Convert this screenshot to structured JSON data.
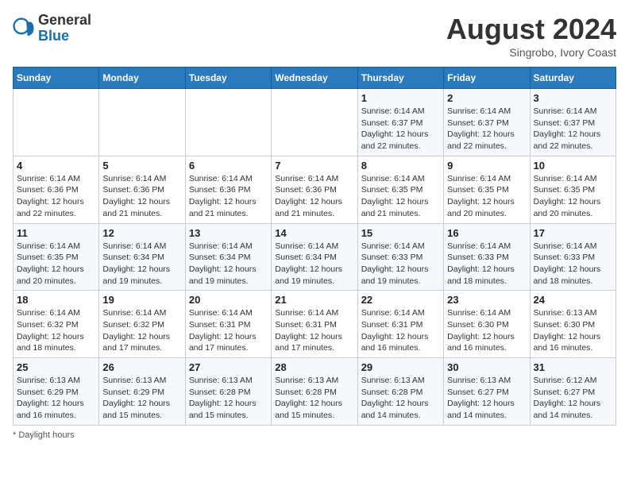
{
  "header": {
    "logo_general": "General",
    "logo_blue": "Blue",
    "month_year": "August 2024",
    "location": "Singrobo, Ivory Coast"
  },
  "days_of_week": [
    "Sunday",
    "Monday",
    "Tuesday",
    "Wednesday",
    "Thursday",
    "Friday",
    "Saturday"
  ],
  "weeks": [
    [
      {
        "day": "",
        "sunrise": "",
        "sunset": "",
        "daylight": ""
      },
      {
        "day": "",
        "sunrise": "",
        "sunset": "",
        "daylight": ""
      },
      {
        "day": "",
        "sunrise": "",
        "sunset": "",
        "daylight": ""
      },
      {
        "day": "",
        "sunrise": "",
        "sunset": "",
        "daylight": ""
      },
      {
        "day": "1",
        "sunrise": "Sunrise: 6:14 AM",
        "sunset": "Sunset: 6:37 PM",
        "daylight": "Daylight: 12 hours and 22 minutes."
      },
      {
        "day": "2",
        "sunrise": "Sunrise: 6:14 AM",
        "sunset": "Sunset: 6:37 PM",
        "daylight": "Daylight: 12 hours and 22 minutes."
      },
      {
        "day": "3",
        "sunrise": "Sunrise: 6:14 AM",
        "sunset": "Sunset: 6:37 PM",
        "daylight": "Daylight: 12 hours and 22 minutes."
      }
    ],
    [
      {
        "day": "4",
        "sunrise": "Sunrise: 6:14 AM",
        "sunset": "Sunset: 6:36 PM",
        "daylight": "Daylight: 12 hours and 22 minutes."
      },
      {
        "day": "5",
        "sunrise": "Sunrise: 6:14 AM",
        "sunset": "Sunset: 6:36 PM",
        "daylight": "Daylight: 12 hours and 21 minutes."
      },
      {
        "day": "6",
        "sunrise": "Sunrise: 6:14 AM",
        "sunset": "Sunset: 6:36 PM",
        "daylight": "Daylight: 12 hours and 21 minutes."
      },
      {
        "day": "7",
        "sunrise": "Sunrise: 6:14 AM",
        "sunset": "Sunset: 6:36 PM",
        "daylight": "Daylight: 12 hours and 21 minutes."
      },
      {
        "day": "8",
        "sunrise": "Sunrise: 6:14 AM",
        "sunset": "Sunset: 6:35 PM",
        "daylight": "Daylight: 12 hours and 21 minutes."
      },
      {
        "day": "9",
        "sunrise": "Sunrise: 6:14 AM",
        "sunset": "Sunset: 6:35 PM",
        "daylight": "Daylight: 12 hours and 20 minutes."
      },
      {
        "day": "10",
        "sunrise": "Sunrise: 6:14 AM",
        "sunset": "Sunset: 6:35 PM",
        "daylight": "Daylight: 12 hours and 20 minutes."
      }
    ],
    [
      {
        "day": "11",
        "sunrise": "Sunrise: 6:14 AM",
        "sunset": "Sunset: 6:35 PM",
        "daylight": "Daylight: 12 hours and 20 minutes."
      },
      {
        "day": "12",
        "sunrise": "Sunrise: 6:14 AM",
        "sunset": "Sunset: 6:34 PM",
        "daylight": "Daylight: 12 hours and 19 minutes."
      },
      {
        "day": "13",
        "sunrise": "Sunrise: 6:14 AM",
        "sunset": "Sunset: 6:34 PM",
        "daylight": "Daylight: 12 hours and 19 minutes."
      },
      {
        "day": "14",
        "sunrise": "Sunrise: 6:14 AM",
        "sunset": "Sunset: 6:34 PM",
        "daylight": "Daylight: 12 hours and 19 minutes."
      },
      {
        "day": "15",
        "sunrise": "Sunrise: 6:14 AM",
        "sunset": "Sunset: 6:33 PM",
        "daylight": "Daylight: 12 hours and 19 minutes."
      },
      {
        "day": "16",
        "sunrise": "Sunrise: 6:14 AM",
        "sunset": "Sunset: 6:33 PM",
        "daylight": "Daylight: 12 hours and 18 minutes."
      },
      {
        "day": "17",
        "sunrise": "Sunrise: 6:14 AM",
        "sunset": "Sunset: 6:33 PM",
        "daylight": "Daylight: 12 hours and 18 minutes."
      }
    ],
    [
      {
        "day": "18",
        "sunrise": "Sunrise: 6:14 AM",
        "sunset": "Sunset: 6:32 PM",
        "daylight": "Daylight: 12 hours and 18 minutes."
      },
      {
        "day": "19",
        "sunrise": "Sunrise: 6:14 AM",
        "sunset": "Sunset: 6:32 PM",
        "daylight": "Daylight: 12 hours and 17 minutes."
      },
      {
        "day": "20",
        "sunrise": "Sunrise: 6:14 AM",
        "sunset": "Sunset: 6:31 PM",
        "daylight": "Daylight: 12 hours and 17 minutes."
      },
      {
        "day": "21",
        "sunrise": "Sunrise: 6:14 AM",
        "sunset": "Sunset: 6:31 PM",
        "daylight": "Daylight: 12 hours and 17 minutes."
      },
      {
        "day": "22",
        "sunrise": "Sunrise: 6:14 AM",
        "sunset": "Sunset: 6:31 PM",
        "daylight": "Daylight: 12 hours and 16 minutes."
      },
      {
        "day": "23",
        "sunrise": "Sunrise: 6:14 AM",
        "sunset": "Sunset: 6:30 PM",
        "daylight": "Daylight: 12 hours and 16 minutes."
      },
      {
        "day": "24",
        "sunrise": "Sunrise: 6:13 AM",
        "sunset": "Sunset: 6:30 PM",
        "daylight": "Daylight: 12 hours and 16 minutes."
      }
    ],
    [
      {
        "day": "25",
        "sunrise": "Sunrise: 6:13 AM",
        "sunset": "Sunset: 6:29 PM",
        "daylight": "Daylight: 12 hours and 16 minutes."
      },
      {
        "day": "26",
        "sunrise": "Sunrise: 6:13 AM",
        "sunset": "Sunset: 6:29 PM",
        "daylight": "Daylight: 12 hours and 15 minutes."
      },
      {
        "day": "27",
        "sunrise": "Sunrise: 6:13 AM",
        "sunset": "Sunset: 6:28 PM",
        "daylight": "Daylight: 12 hours and 15 minutes."
      },
      {
        "day": "28",
        "sunrise": "Sunrise: 6:13 AM",
        "sunset": "Sunset: 6:28 PM",
        "daylight": "Daylight: 12 hours and 15 minutes."
      },
      {
        "day": "29",
        "sunrise": "Sunrise: 6:13 AM",
        "sunset": "Sunset: 6:28 PM",
        "daylight": "Daylight: 12 hours and 14 minutes."
      },
      {
        "day": "30",
        "sunrise": "Sunrise: 6:13 AM",
        "sunset": "Sunset: 6:27 PM",
        "daylight": "Daylight: 12 hours and 14 minutes."
      },
      {
        "day": "31",
        "sunrise": "Sunrise: 6:12 AM",
        "sunset": "Sunset: 6:27 PM",
        "daylight": "Daylight: 12 hours and 14 minutes."
      }
    ]
  ],
  "footer": {
    "note": "Daylight hours"
  }
}
